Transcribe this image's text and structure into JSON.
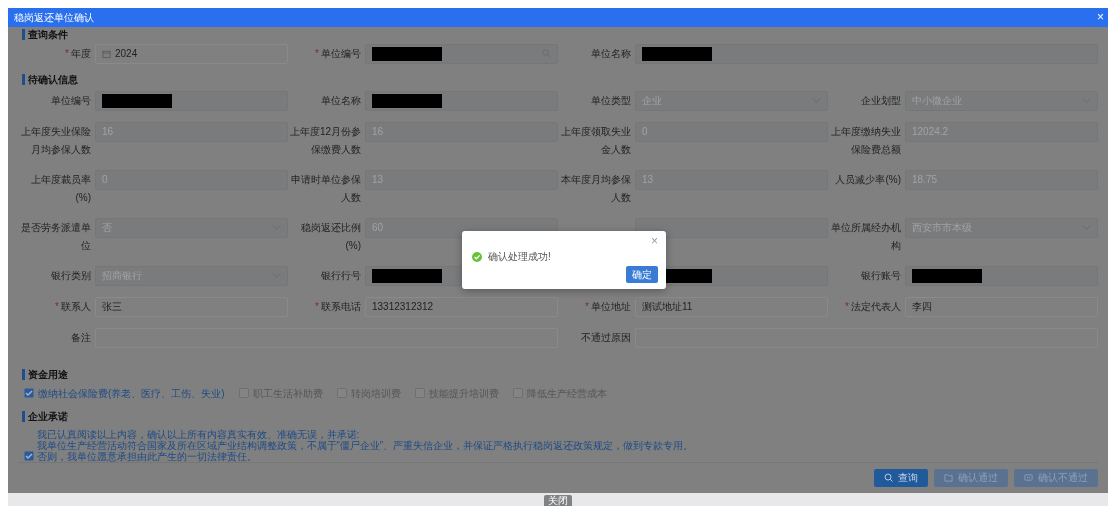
{
  "window": {
    "title": "稳岗返还单位确认",
    "close": "×"
  },
  "required_mark": "*",
  "query": {
    "title": "查询条件",
    "rows": [
      [
        {
          "label": "年度",
          "required": true,
          "kind": "date",
          "value": "2024",
          "disabled": false
        },
        {
          "label": "单位编号",
          "required": true,
          "kind": "search",
          "disabled": true,
          "redacted": true
        },
        {
          "label": "单位名称",
          "kind": "text",
          "disabled": true,
          "redacted": true,
          "colspan": 2
        }
      ]
    ]
  },
  "pending": {
    "title": "待确认信息",
    "rows": [
      [
        {
          "label": "单位编号",
          "kind": "text",
          "disabled": true,
          "redacted": true
        },
        {
          "label": "单位名称",
          "kind": "text",
          "disabled": true,
          "redacted": true
        },
        {
          "label": "单位类型",
          "kind": "select",
          "value": "企业",
          "disabled": true
        },
        {
          "label": "企业划型",
          "kind": "select",
          "value": "中小微企业",
          "disabled": true
        }
      ],
      [
        {
          "label": "上年度失业保险月均参保人数",
          "kind": "text",
          "value": "16",
          "disabled": true
        },
        {
          "label": "上年度12月份参保缴费人数",
          "kind": "text",
          "value": "16",
          "disabled": true
        },
        {
          "label": "上年度领取失业金人数",
          "kind": "text",
          "value": "0",
          "disabled": true
        },
        {
          "label": "上年度缴纳失业保险费总额",
          "kind": "text",
          "value": "12024.2",
          "disabled": true
        }
      ],
      [
        {
          "label": "上年度裁员率(%)",
          "kind": "text",
          "value": "0",
          "disabled": true
        },
        {
          "label": "申请时单位参保人数",
          "kind": "text",
          "value": "13",
          "disabled": true
        },
        {
          "label": "本年度月均参保人数",
          "kind": "text",
          "value": "13",
          "disabled": true
        },
        {
          "label": "人员减少率(%)",
          "kind": "text",
          "value": "18.75",
          "disabled": true
        }
      ],
      [
        {
          "label": "是否劳务派遣单位",
          "kind": "select",
          "value": "否",
          "disabled": true
        },
        {
          "label": "稳岗返还比例(%)",
          "kind": "text",
          "value": "60",
          "disabled": true
        },
        {
          "kind": "text",
          "disabled": true
        },
        {
          "label": "单位所属经办机构",
          "kind": "select",
          "value": "西安市市本级",
          "disabled": true
        }
      ],
      [
        {
          "label": "银行类别",
          "kind": "select",
          "value": "招商银行",
          "disabled": true
        },
        {
          "label": "银行行号",
          "kind": "text",
          "disabled": true,
          "redacted": true
        },
        {
          "kind": "text",
          "disabled": true,
          "redacted": true
        },
        {
          "label": "银行账号",
          "kind": "text",
          "disabled": true,
          "redacted": true
        }
      ],
      [
        {
          "label": "联系人",
          "required": true,
          "kind": "text",
          "value": "张三",
          "disabled": false
        },
        {
          "label": "联系电话",
          "required": true,
          "kind": "text",
          "value": "13312312312",
          "disabled": false
        },
        {
          "label": "单位地址",
          "required": true,
          "kind": "text",
          "value": "测试地址11",
          "disabled": false
        },
        {
          "label": "法定代表人",
          "required": true,
          "kind": "text",
          "value": "李四",
          "disabled": false
        }
      ],
      [
        {
          "label": "备注",
          "kind": "text",
          "disabled": false,
          "colspan": 2
        },
        {
          "label": "不通过原因",
          "kind": "text",
          "disabled": false,
          "colspan": 2
        }
      ]
    ]
  },
  "fund_use": {
    "title": "资金用途",
    "options": [
      {
        "label": "缴纳社会保险费(养老、医疗、工伤、失业)",
        "checked": true
      },
      {
        "label": "职工生活补助费",
        "checked": false
      },
      {
        "label": "转岗培训费",
        "checked": false
      },
      {
        "label": "技能提升培训费",
        "checked": false
      },
      {
        "label": "降低生产经营成本",
        "checked": false
      }
    ]
  },
  "promise": {
    "title": "企业承诺",
    "checked": true,
    "lines": [
      "我已认真阅读以上内容，确认以上所有内容真实有效、准确无误，并承诺:",
      "我单位生产经营活动符合国家及所在区域产业结构调整政策，不属于“僵尸企业”、严重失信企业，并保证严格执行稳岗返还政策规定，做到专款专用。",
      "否则，我单位愿意承担由此产生的一切法律责任。"
    ]
  },
  "actions": [
    {
      "label": "查询",
      "kind": "search",
      "disabled": false
    },
    {
      "label": "确认通过",
      "kind": "approve",
      "disabled": true
    },
    {
      "label": "确认不通过",
      "kind": "reject",
      "disabled": true
    }
  ],
  "footer": {
    "close_button": "关闭"
  },
  "message_box": {
    "kind": "success",
    "message": "确认处理成功!",
    "close": "×",
    "button": "确定"
  }
}
